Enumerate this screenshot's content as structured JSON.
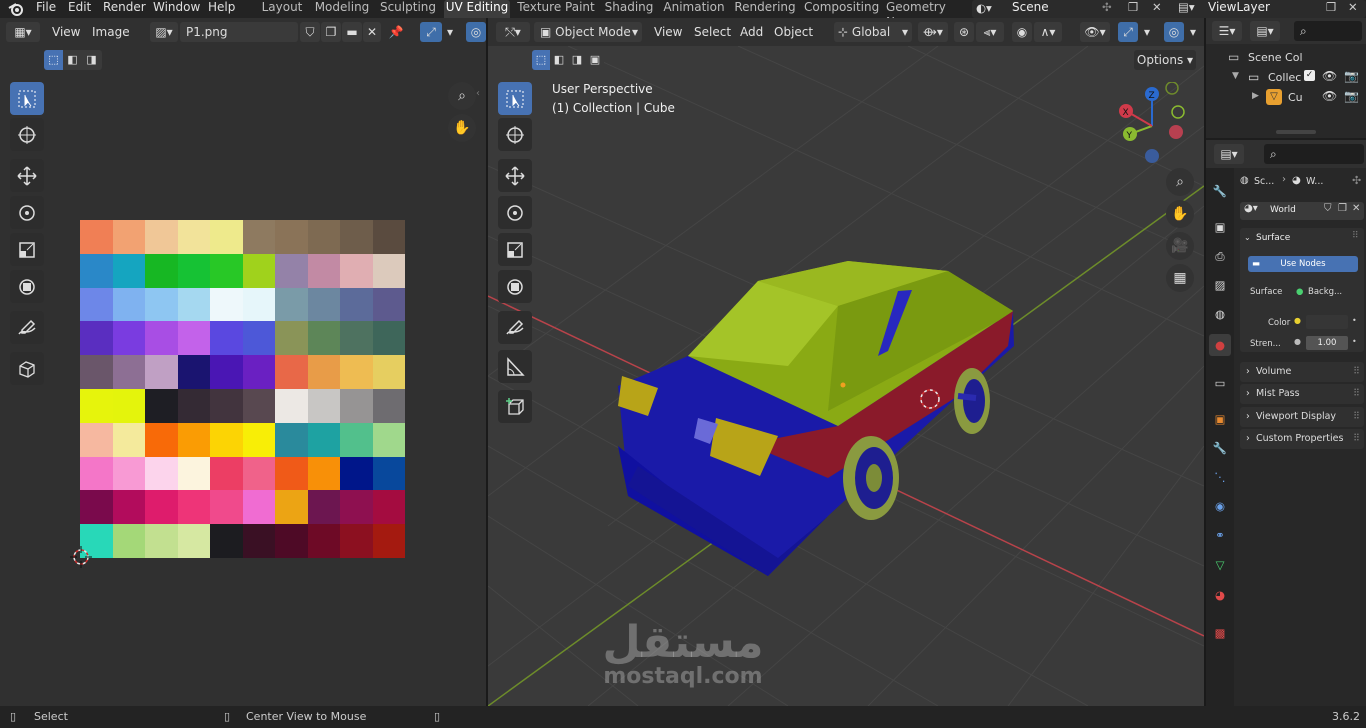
{
  "menus": [
    "File",
    "Edit",
    "Render",
    "Window",
    "Help"
  ],
  "workspaces": [
    {
      "label": "Layout",
      "active": false
    },
    {
      "label": "Modeling",
      "active": false
    },
    {
      "label": "Sculpting",
      "active": false
    },
    {
      "label": "UV Editing",
      "active": true
    },
    {
      "label": "Texture Paint",
      "active": false
    },
    {
      "label": "Shading",
      "active": false
    },
    {
      "label": "Animation",
      "active": false
    },
    {
      "label": "Rendering",
      "active": false
    },
    {
      "label": "Compositing",
      "active": false
    },
    {
      "label": "Geometry Noc",
      "active": false
    }
  ],
  "scene_name": "Scene",
  "view_layer": "ViewLayer",
  "uv_editor": {
    "menu_view": "View",
    "menu_image": "Image",
    "image_name": "P1.png",
    "palette": [
      "#f07f55",
      "#f2a272",
      "#f0c797",
      "#f2e39a",
      "#eeea8c",
      "#8e7a60",
      "#8a7358",
      "#7e6a52",
      "#6e5d4b",
      "#5a4b3f",
      "#2a88c8",
      "#15a5c0",
      "#17b723",
      "#16c234",
      "#28c826",
      "#a0d21c",
      "#9482a8",
      "#c28aa4",
      "#e0aeb2",
      "#dccabc",
      "#6d87e8",
      "#7fb2f0",
      "#8ec6f2",
      "#a5d8f0",
      "#eef8fb",
      "#e6f6fa",
      "#7a9ba8",
      "#6c87a0",
      "#5c6b9a",
      "#5d5a8e",
      "#5a2ec0",
      "#7a3ce0",
      "#a84ee4",
      "#c362ea",
      "#5a48e0",
      "#4d58d8",
      "#8a9458",
      "#5d8658",
      "#4e7260",
      "#3e665a",
      "#6a566a",
      "#8d6f94",
      "#c0a0c4",
      "#1a1470",
      "#4a16b4",
      "#6a20c2",
      "#e86848",
      "#e89c48",
      "#eebc52",
      "#e6ce60",
      "#e6f40c",
      "#e4f40c",
      "#1e1e24",
      "#342a34",
      "#42343e",
      "#584850",
      "#ece8e4",
      "#c8c6c4",
      "#969494",
      "#6e6c70",
      "#f6b8a0",
      "#f4ea9c",
      "#f86a08",
      "#fa9c04",
      "#fcd404",
      "#f8ee06",
      "#2a8a9c",
      "#1ea2a2",
      "#52c08c",
      "#a0d88c",
      "#f476c8",
      "#f89ad4",
      "#fcd4ec",
      "#fcf4de",
      "#ec3e64",
      "#f0628a",
      "#f05a18",
      "#f89008",
      "#00168a",
      "#08489c",
      "#7a0a4c",
      "#b20c5c",
      "#de1c6c",
      "#ee3478",
      "#f04a8c",
      "#f06cd2",
      "#eca414",
      "#6c1650",
      "#8e1050",
      "#a40c40",
      "#28d8b8",
      "#a4d878",
      "#c2e090",
      "#d6e8a2",
      "#1c1c20",
      "#3a1024",
      "#4e0a26",
      "#6e0a26",
      "#8c1020",
      "#a41a10"
    ]
  },
  "viewport3d": {
    "mode": "Object Mode",
    "menu_view": "View",
    "menu_select": "Select",
    "menu_add": "Add",
    "menu_object": "Object",
    "transform_orientation": "Global",
    "options_label": "Options",
    "perspective": "User Perspective",
    "collection_info": "(1) Collection | Cube",
    "axis_x": "X",
    "axis_y": "Y",
    "axis_z": "Z",
    "watermark_arabic": "مستقل",
    "watermark_latin": "mostaql.com"
  },
  "outliner": {
    "scene_collection": "Scene Col",
    "collection": "Collec",
    "object": "Cu"
  },
  "properties": {
    "breadcrumb_scene": "Sc...",
    "breadcrumb_world": "W...",
    "world_name": "World",
    "surface_panel": "Surface",
    "use_nodes": "Use Nodes",
    "surface_label": "Surface",
    "surface_value": "Backg...",
    "color_label": "Color",
    "strength_label": "Stren...",
    "strength_value": "1.00",
    "volume_panel": "Volume",
    "mist_panel": "Mist Pass",
    "viewport_display_panel": "Viewport Display",
    "custom_props_panel": "Custom Properties"
  },
  "status": {
    "select": "Select",
    "center_view": "Center View to Mouse",
    "version": "3.6.2"
  },
  "colors": {
    "accent": "#4772b3",
    "header": "#303030",
    "viewport": "#3a3a3a",
    "car_body": "#1a1aa8",
    "car_top": "#8aaa14",
    "car_red": "#8a1a2a"
  }
}
